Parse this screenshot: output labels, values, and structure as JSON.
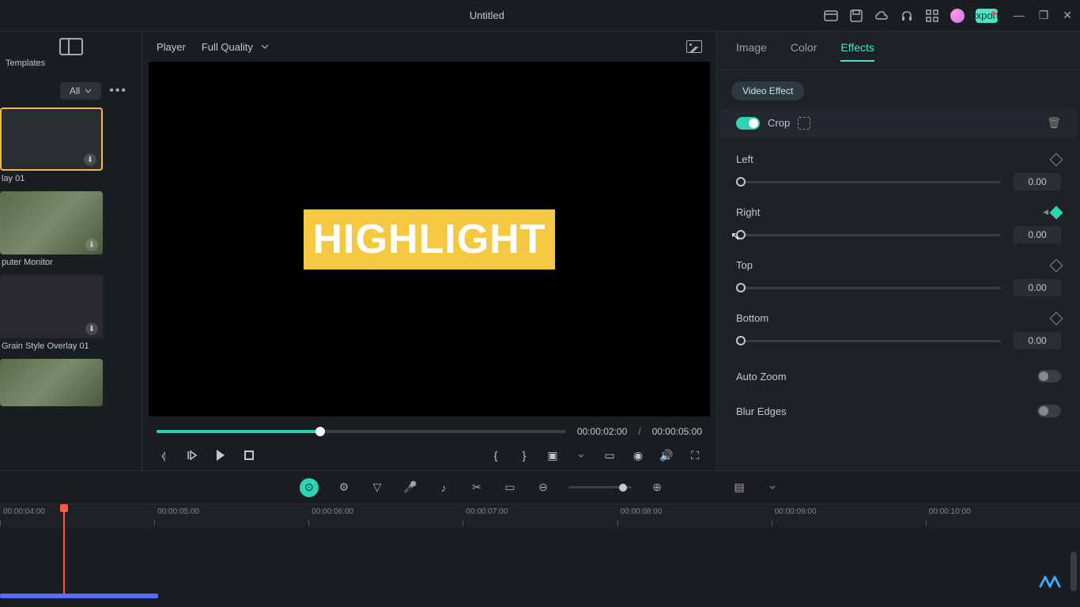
{
  "titlebar": {
    "title": "Untitled",
    "export": "Export"
  },
  "leftPanel": {
    "header": "Templates",
    "filter": "All",
    "dots": "•••",
    "items": [
      {
        "name": "lay 01",
        "selected": true
      },
      {
        "name": "puter Monitor",
        "selected": false
      },
      {
        "name": "Grain Style Overlay 01",
        "selected": false
      },
      {
        "name": "",
        "selected": false
      }
    ]
  },
  "player": {
    "label": "Player",
    "quality": "Full Quality",
    "highlightText": "HIGHLIGHT",
    "currentTime": "00:00:02:00",
    "sep": "/",
    "totalTime": "00:00:05:00"
  },
  "rightPanel": {
    "tabs": {
      "image": "Image",
      "color": "Color",
      "effects": "Effects"
    },
    "chip": "Video Effect",
    "crop": {
      "label": "Crop"
    },
    "sliders": {
      "left": {
        "label": "Left",
        "value": "0.00"
      },
      "right": {
        "label": "Right",
        "value": "0.00"
      },
      "top": {
        "label": "Top",
        "value": "0.00"
      },
      "bottom": {
        "label": "Bottom",
        "value": "0.00"
      }
    },
    "autoZoom": "Auto Zoom",
    "blurEdges": "Blur Edges"
  },
  "timeline": {
    "marks": [
      "00:00:04:00",
      "00:00:05:00",
      "00:00:06:00",
      "00:00:07:00",
      "00:00:08:00",
      "00:00:09:00",
      "00:00:10:00"
    ]
  }
}
